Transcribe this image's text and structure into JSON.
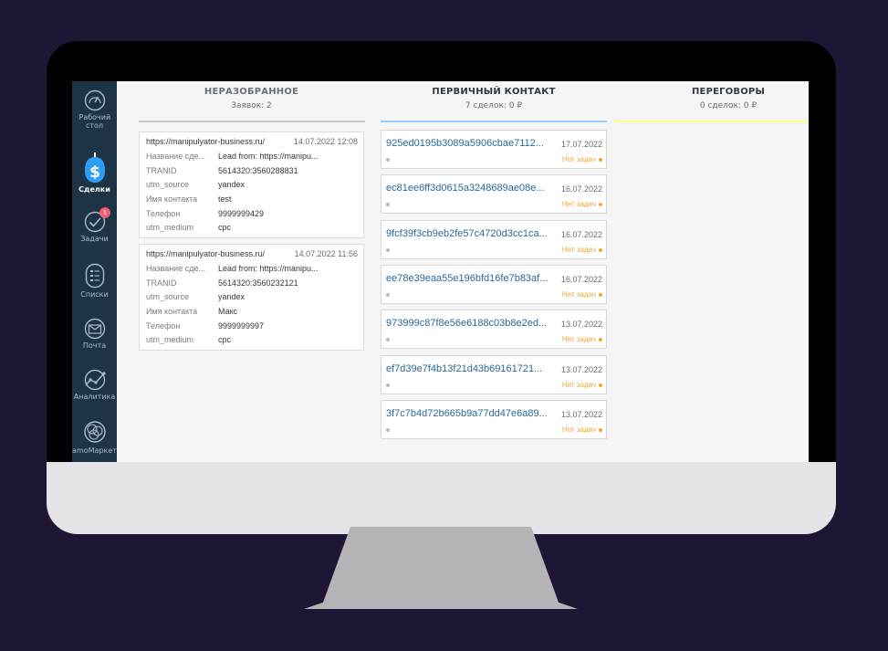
{
  "sidebar": {
    "items": [
      {
        "label": "Рабочий стол",
        "icon": "dashboard-gauge-icon"
      },
      {
        "label": "Сделки",
        "icon": "leads-dollar-icon",
        "active": true
      },
      {
        "label": "Задачи",
        "icon": "tasks-check-icon",
        "badge": "1"
      },
      {
        "label": "Списки",
        "icon": "lists-icon"
      },
      {
        "label": "Почта",
        "icon": "mail-icon"
      },
      {
        "label": "Аналитика",
        "icon": "analytics-chart-icon"
      },
      {
        "label": "amoМаркет",
        "icon": "marketplace-icon"
      }
    ]
  },
  "columns": [
    {
      "title": "НЕРАЗОБРАННОЕ",
      "subtitle": "Заявок: 2",
      "accent": "#c9c9c9"
    },
    {
      "title": "ПЕРВИЧНЫЙ КОНТАКТ",
      "subtitle": "7 сделок: 0 ₽",
      "accent": "#99ccff"
    },
    {
      "title": "ПЕРЕГОВОРЫ",
      "subtitle": "0 сделок: 0 ₽",
      "accent": "#fffd7f"
    }
  ],
  "unsorted_leads": [
    {
      "source": "https://manipulyator-business.ru/",
      "date": "14.07.2022 12:08",
      "fields": [
        {
          "key": "Название сде...",
          "value": "Lead from: https://manipu..."
        },
        {
          "key": "TRANID",
          "value": "5614320:3560288831"
        },
        {
          "key": "utm_source",
          "value": "yandex"
        },
        {
          "key": "Имя контакта",
          "value": "test"
        },
        {
          "key": "Телефон",
          "value": "9999999429"
        },
        {
          "key": "utm_medium",
          "value": "cpc"
        }
      ]
    },
    {
      "source": "https://manipulyator-business.ru/",
      "date": "14.07.2022 11:56",
      "fields": [
        {
          "key": "Название сде...",
          "value": "Lead from: https://manipu..."
        },
        {
          "key": "TRANID",
          "value": "5614320:3560232121"
        },
        {
          "key": "utm_source",
          "value": "yandex"
        },
        {
          "key": "Имя контакта",
          "value": "Макс"
        },
        {
          "key": "Телефон",
          "value": "9999999997"
        },
        {
          "key": "utm_medium",
          "value": "cpc"
        }
      ]
    }
  ],
  "deals": [
    {
      "name": "925ed0195b3089a5906cbae7112...",
      "date": "17.07.2022",
      "task": "Нет задач"
    },
    {
      "name": "ec81ee6ff3d0615a3248689ae08e...",
      "date": "16.07.2022",
      "task": "Нет задач"
    },
    {
      "name": "9fcf39f3cb9eb2fe57c4720d3cc1ca...",
      "date": "16.07.2022",
      "task": "Нет задач"
    },
    {
      "name": "ee78e39eaa55e196bfd16fe7b83af...",
      "date": "16.07.2022",
      "task": "Нет задач"
    },
    {
      "name": "973999c87f8e56e6188c03b8e2ed...",
      "date": "13.07.2022",
      "task": "Нет задач"
    },
    {
      "name": "ef7d39e7f4b13f21d43b69161721...",
      "date": "13.07.2022",
      "task": "Нет задач"
    },
    {
      "name": "3f7c7b4d72b665b9a77dd47e6a89...",
      "date": "13.07.2022",
      "task": "Нет задач"
    }
  ]
}
